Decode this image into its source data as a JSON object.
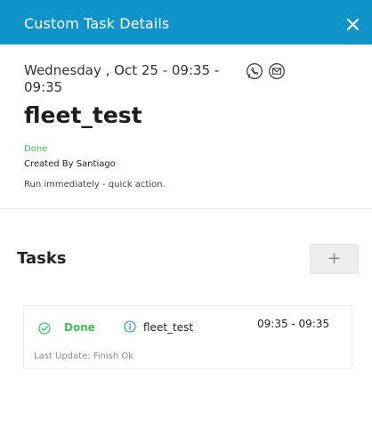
{
  "header": {
    "title": "Custom Task Details",
    "close_icon": "close-icon"
  },
  "details": {
    "datetime": "Wednesday , Oct 25 - 09:35 - 09:35",
    "contact_icons": [
      "whatsapp-icon",
      "email-icon"
    ],
    "task_name": "fleet_test",
    "status": "Done",
    "created_by": "Created By Santiago",
    "description": "Run immediately - quick action."
  },
  "tasks": {
    "title": "Tasks",
    "add_label": "+",
    "items": [
      {
        "status": "Done",
        "name": "fleet_test",
        "time": "09:35 - 09:35",
        "last_update": "Last Update: Finish Ok"
      }
    ]
  },
  "colors": {
    "header_bg": "#0f93c8",
    "done_green": "#3ec25a",
    "info_blue": "#1a8fd0"
  }
}
